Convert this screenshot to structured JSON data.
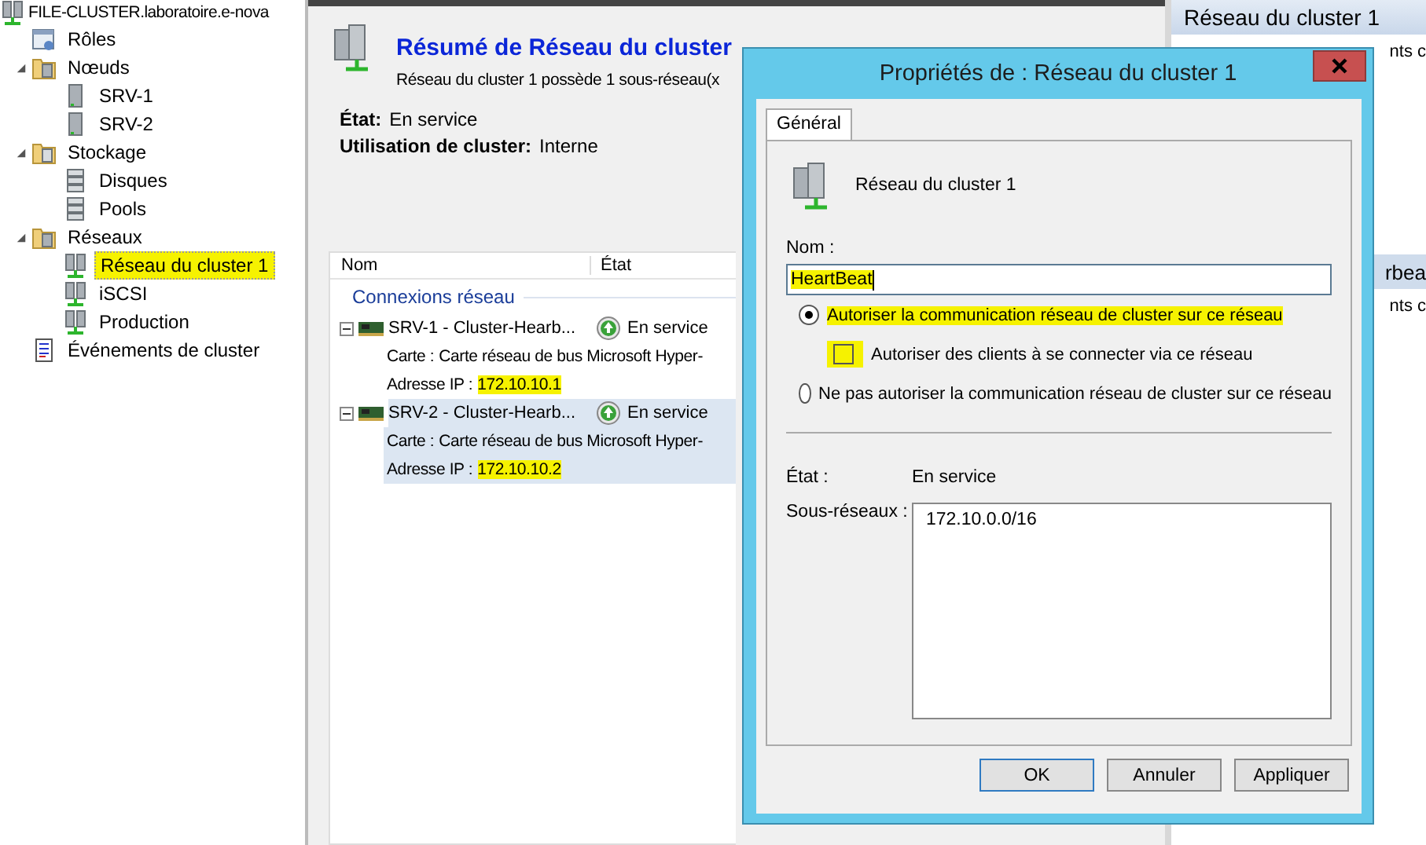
{
  "tree": {
    "label": "FILE-CLUSTER.laboratoire.e-nova",
    "kind": "cluster",
    "selected": false,
    "children": [
      {
        "label": "Rôles",
        "kind": "roles",
        "selected": false
      },
      {
        "label": "Nœuds",
        "kind": "folder",
        "expanded": true,
        "selected": false,
        "children": [
          {
            "label": "SRV-1",
            "kind": "server",
            "selected": false
          },
          {
            "label": "SRV-2",
            "kind": "server",
            "selected": false
          }
        ]
      },
      {
        "label": "Stockage",
        "kind": "storage",
        "expanded": true,
        "selected": false,
        "children": [
          {
            "label": "Disques",
            "kind": "disks",
            "selected": false
          },
          {
            "label": "Pools",
            "kind": "pool",
            "selected": false
          }
        ]
      },
      {
        "label": "Réseaux",
        "kind": "folder-network",
        "expanded": true,
        "selected": false,
        "children": [
          {
            "label": "Réseau du cluster 1",
            "kind": "network",
            "selected": true,
            "highlighted": true
          },
          {
            "label": "iSCSI",
            "kind": "network",
            "selected": false
          },
          {
            "label": "Production",
            "kind": "network",
            "selected": false
          }
        ]
      },
      {
        "label": "Événements de cluster",
        "kind": "events",
        "selected": false
      }
    ]
  },
  "summary": {
    "title": "Résumé de Réseau du cluster",
    "subtitle": "Réseau du cluster 1 possède 1 sous-réseau(x",
    "fields": [
      {
        "label": "État:",
        "value": "En service"
      },
      {
        "label": "Utilisation de cluster:",
        "value": "Interne"
      }
    ]
  },
  "connections": {
    "columns": [
      "Nom",
      "État"
    ],
    "group": "Connexions réseau",
    "items": [
      {
        "name": "SRV-1 - Cluster-Hearb...",
        "status": "En service",
        "expanded": true,
        "selected": false,
        "details": [
          {
            "label": "Carte :",
            "value": "Carte réseau de bus Microsoft Hyper-",
            "highlighted": false
          },
          {
            "label": "Adresse IP :",
            "value": "172.10.10.1",
            "highlighted": true
          }
        ]
      },
      {
        "name": "SRV-2 - Cluster-Hearb...",
        "status": "En service",
        "expanded": true,
        "selected": true,
        "details": [
          {
            "label": "Carte :",
            "value": "Carte réseau de bus Microsoft Hyper-",
            "highlighted": false
          },
          {
            "label": "Adresse IP :",
            "value": "172.10.10.2",
            "highlighted": true
          }
        ]
      }
    ]
  },
  "actions": {
    "header": "Réseau du cluster 1",
    "fragments": [
      {
        "kind": "item",
        "text": "nts c"
      },
      {
        "kind": "header",
        "text": "rbea"
      },
      {
        "kind": "item",
        "text": "nts c"
      }
    ]
  },
  "dialog": {
    "title": "Propriétés de : Réseau du cluster 1",
    "tabs": [
      {
        "label": "Général",
        "selected": true
      }
    ],
    "network_name": "Réseau du cluster 1",
    "name_label": "Nom :",
    "name_value": "HeartBeat",
    "name_highlighted": true,
    "options": [
      {
        "kind": "radio",
        "label": "Autoriser la communication réseau de cluster sur ce réseau",
        "selected": true,
        "highlighted": true
      },
      {
        "kind": "checkbox",
        "label": "Autoriser des clients à se connecter via ce réseau",
        "checked": false,
        "highlighted": true
      },
      {
        "kind": "radio",
        "label": "Ne pas autoriser la communication réseau de cluster sur ce réseau",
        "selected": false,
        "highlighted": false
      }
    ],
    "status_label": "État :",
    "status_value": "En service",
    "subnets_label": "Sous-réseaux :",
    "subnets": [
      "172.10.0.0/16"
    ],
    "buttons": [
      {
        "label": "OK",
        "default": true
      },
      {
        "label": "Annuler",
        "default": false
      },
      {
        "label": "Appliquer",
        "default": false
      }
    ]
  }
}
